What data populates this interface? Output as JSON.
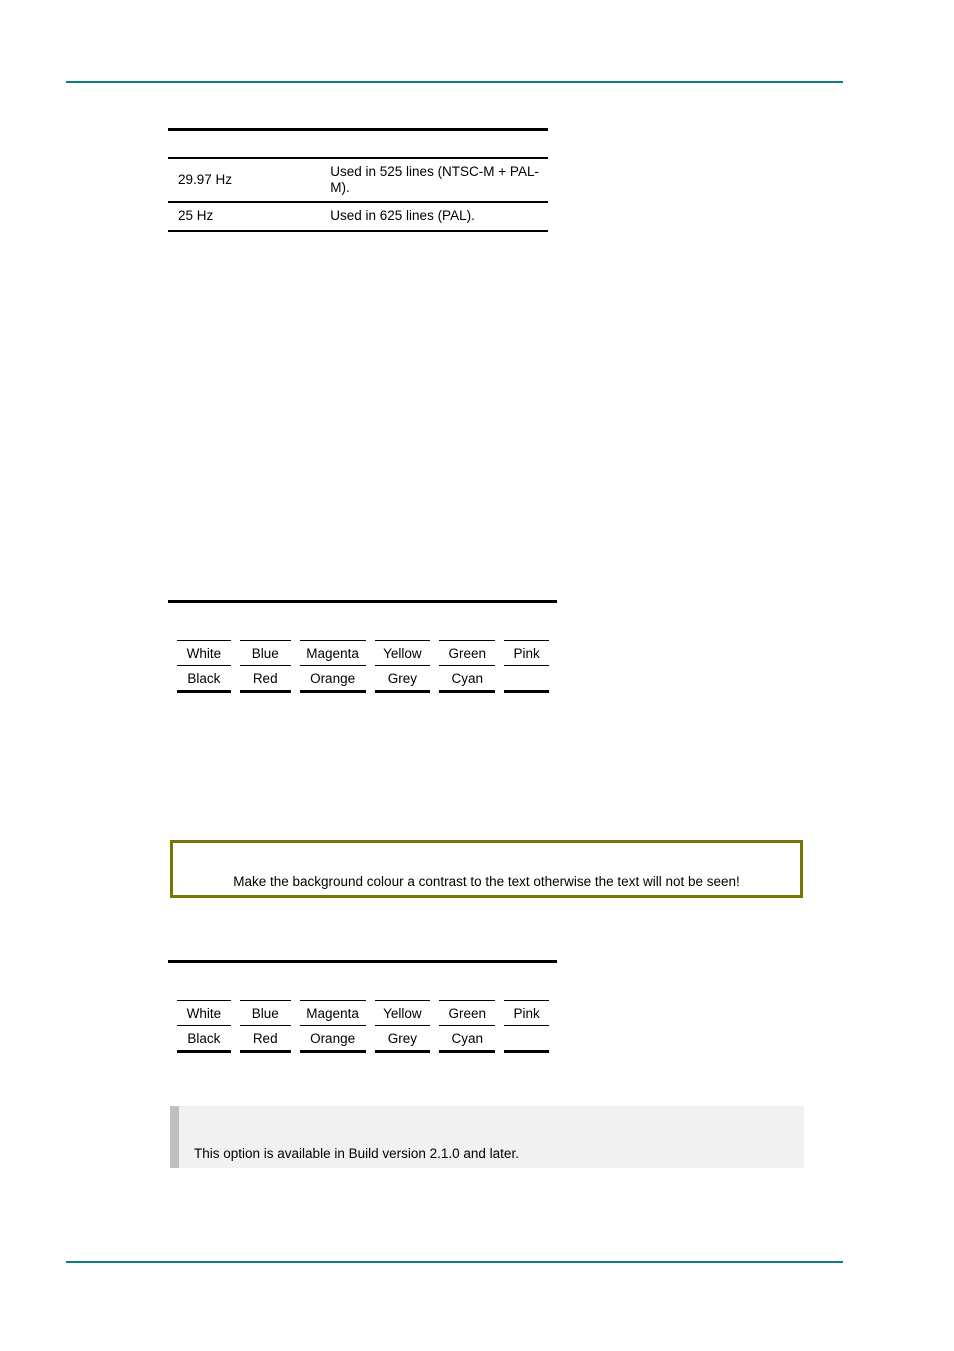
{
  "page": {
    "header_rule_color": "#0b7b80",
    "footer_rule_color": "#0b7b80"
  },
  "spec_table": {
    "rows": [
      {
        "frequency": "29.97 Hz",
        "description": "Used in 525 lines (NTSC-M + PAL-M)."
      },
      {
        "frequency": "25 Hz",
        "description": "Used in 625 lines (PAL)."
      }
    ]
  },
  "colour_table_1": {
    "row1": [
      "White",
      "Blue",
      "Magenta",
      "Yellow",
      "Green",
      "Pink"
    ],
    "row2": [
      "Black",
      "Red",
      "Orange",
      "Grey",
      "Cyan",
      ""
    ]
  },
  "colour_table_2": {
    "row1": [
      "White",
      "Blue",
      "Magenta",
      "Yellow",
      "Green",
      "Pink"
    ],
    "row2": [
      "Black",
      "Red",
      "Orange",
      "Grey",
      "Cyan",
      ""
    ]
  },
  "caution": {
    "text": "Make the background colour a contrast to the text otherwise the text will not be seen!",
    "border_color": "#767606"
  },
  "note": {
    "text": "This option is available in Build version 2.1.0 and later.",
    "background_color": "#f1f1f1",
    "bar_color": "#bfbfbf"
  }
}
